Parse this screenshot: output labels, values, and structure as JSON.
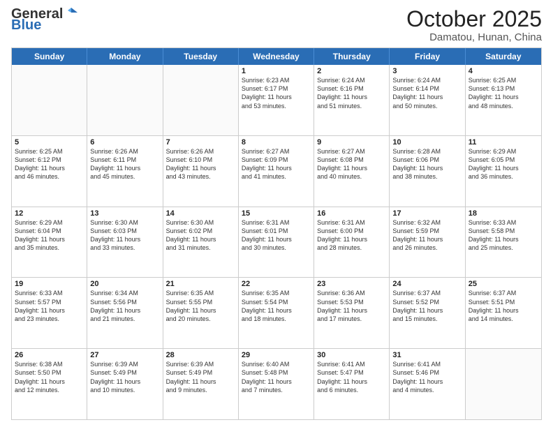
{
  "header": {
    "logo_general": "General",
    "logo_blue": "Blue",
    "month_year": "October 2025",
    "location": "Damatou, Hunan, China"
  },
  "calendar": {
    "days_of_week": [
      "Sunday",
      "Monday",
      "Tuesday",
      "Wednesday",
      "Thursday",
      "Friday",
      "Saturday"
    ],
    "rows": [
      [
        {
          "day": "",
          "text": ""
        },
        {
          "day": "",
          "text": ""
        },
        {
          "day": "",
          "text": ""
        },
        {
          "day": "1",
          "text": "Sunrise: 6:23 AM\nSunset: 6:17 PM\nDaylight: 11 hours\nand 53 minutes."
        },
        {
          "day": "2",
          "text": "Sunrise: 6:24 AM\nSunset: 6:16 PM\nDaylight: 11 hours\nand 51 minutes."
        },
        {
          "day": "3",
          "text": "Sunrise: 6:24 AM\nSunset: 6:14 PM\nDaylight: 11 hours\nand 50 minutes."
        },
        {
          "day": "4",
          "text": "Sunrise: 6:25 AM\nSunset: 6:13 PM\nDaylight: 11 hours\nand 48 minutes."
        }
      ],
      [
        {
          "day": "5",
          "text": "Sunrise: 6:25 AM\nSunset: 6:12 PM\nDaylight: 11 hours\nand 46 minutes."
        },
        {
          "day": "6",
          "text": "Sunrise: 6:26 AM\nSunset: 6:11 PM\nDaylight: 11 hours\nand 45 minutes."
        },
        {
          "day": "7",
          "text": "Sunrise: 6:26 AM\nSunset: 6:10 PM\nDaylight: 11 hours\nand 43 minutes."
        },
        {
          "day": "8",
          "text": "Sunrise: 6:27 AM\nSunset: 6:09 PM\nDaylight: 11 hours\nand 41 minutes."
        },
        {
          "day": "9",
          "text": "Sunrise: 6:27 AM\nSunset: 6:08 PM\nDaylight: 11 hours\nand 40 minutes."
        },
        {
          "day": "10",
          "text": "Sunrise: 6:28 AM\nSunset: 6:06 PM\nDaylight: 11 hours\nand 38 minutes."
        },
        {
          "day": "11",
          "text": "Sunrise: 6:29 AM\nSunset: 6:05 PM\nDaylight: 11 hours\nand 36 minutes."
        }
      ],
      [
        {
          "day": "12",
          "text": "Sunrise: 6:29 AM\nSunset: 6:04 PM\nDaylight: 11 hours\nand 35 minutes."
        },
        {
          "day": "13",
          "text": "Sunrise: 6:30 AM\nSunset: 6:03 PM\nDaylight: 11 hours\nand 33 minutes."
        },
        {
          "day": "14",
          "text": "Sunrise: 6:30 AM\nSunset: 6:02 PM\nDaylight: 11 hours\nand 31 minutes."
        },
        {
          "day": "15",
          "text": "Sunrise: 6:31 AM\nSunset: 6:01 PM\nDaylight: 11 hours\nand 30 minutes."
        },
        {
          "day": "16",
          "text": "Sunrise: 6:31 AM\nSunset: 6:00 PM\nDaylight: 11 hours\nand 28 minutes."
        },
        {
          "day": "17",
          "text": "Sunrise: 6:32 AM\nSunset: 5:59 PM\nDaylight: 11 hours\nand 26 minutes."
        },
        {
          "day": "18",
          "text": "Sunrise: 6:33 AM\nSunset: 5:58 PM\nDaylight: 11 hours\nand 25 minutes."
        }
      ],
      [
        {
          "day": "19",
          "text": "Sunrise: 6:33 AM\nSunset: 5:57 PM\nDaylight: 11 hours\nand 23 minutes."
        },
        {
          "day": "20",
          "text": "Sunrise: 6:34 AM\nSunset: 5:56 PM\nDaylight: 11 hours\nand 21 minutes."
        },
        {
          "day": "21",
          "text": "Sunrise: 6:35 AM\nSunset: 5:55 PM\nDaylight: 11 hours\nand 20 minutes."
        },
        {
          "day": "22",
          "text": "Sunrise: 6:35 AM\nSunset: 5:54 PM\nDaylight: 11 hours\nand 18 minutes."
        },
        {
          "day": "23",
          "text": "Sunrise: 6:36 AM\nSunset: 5:53 PM\nDaylight: 11 hours\nand 17 minutes."
        },
        {
          "day": "24",
          "text": "Sunrise: 6:37 AM\nSunset: 5:52 PM\nDaylight: 11 hours\nand 15 minutes."
        },
        {
          "day": "25",
          "text": "Sunrise: 6:37 AM\nSunset: 5:51 PM\nDaylight: 11 hours\nand 14 minutes."
        }
      ],
      [
        {
          "day": "26",
          "text": "Sunrise: 6:38 AM\nSunset: 5:50 PM\nDaylight: 11 hours\nand 12 minutes."
        },
        {
          "day": "27",
          "text": "Sunrise: 6:39 AM\nSunset: 5:49 PM\nDaylight: 11 hours\nand 10 minutes."
        },
        {
          "day": "28",
          "text": "Sunrise: 6:39 AM\nSunset: 5:49 PM\nDaylight: 11 hours\nand 9 minutes."
        },
        {
          "day": "29",
          "text": "Sunrise: 6:40 AM\nSunset: 5:48 PM\nDaylight: 11 hours\nand 7 minutes."
        },
        {
          "day": "30",
          "text": "Sunrise: 6:41 AM\nSunset: 5:47 PM\nDaylight: 11 hours\nand 6 minutes."
        },
        {
          "day": "31",
          "text": "Sunrise: 6:41 AM\nSunset: 5:46 PM\nDaylight: 11 hours\nand 4 minutes."
        },
        {
          "day": "",
          "text": ""
        }
      ]
    ]
  }
}
